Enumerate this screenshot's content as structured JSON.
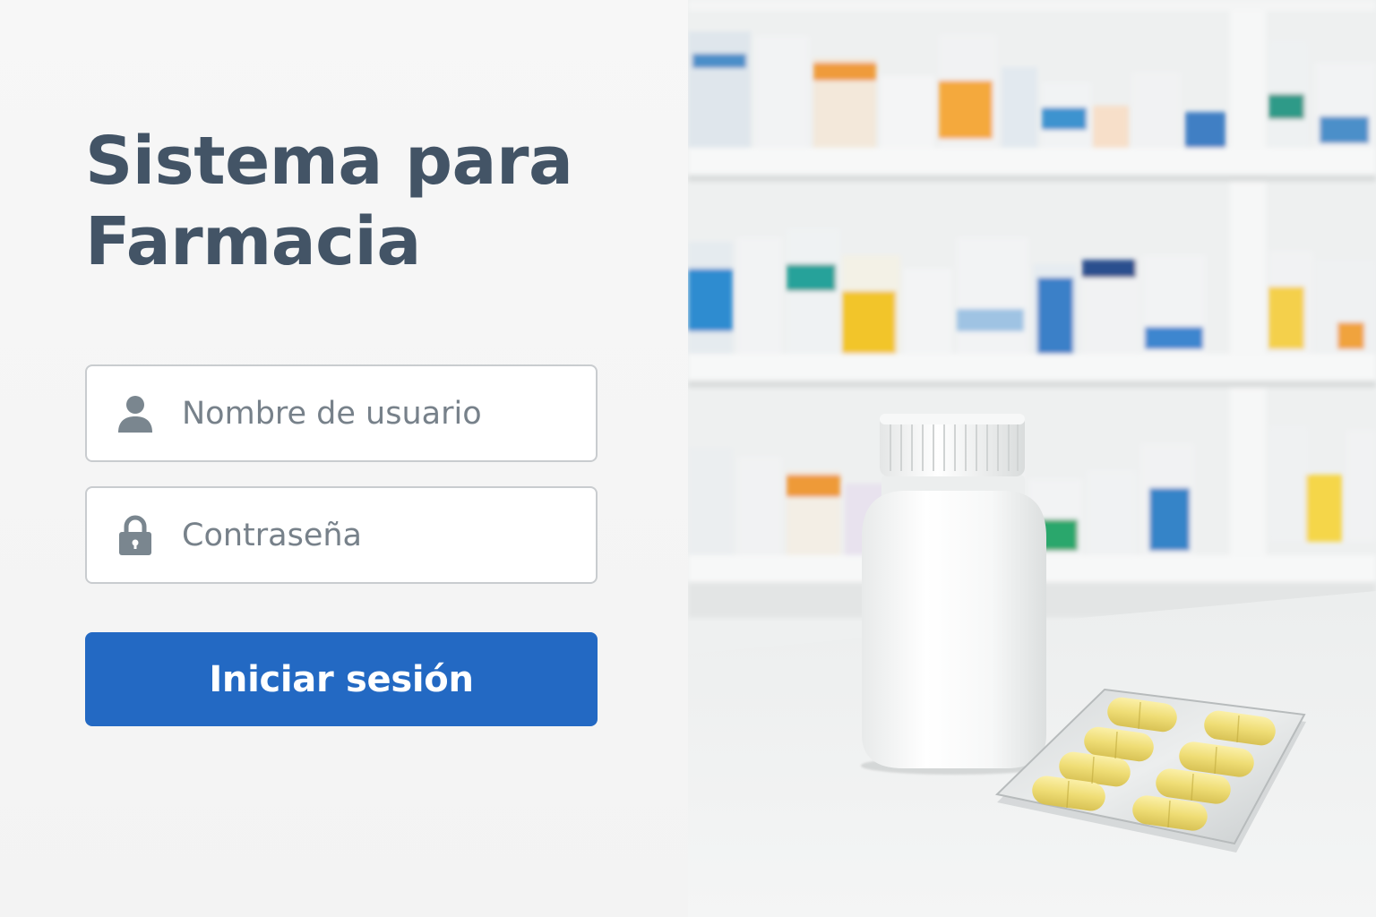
{
  "header": {
    "title": "Sistema para Farmacia"
  },
  "form": {
    "username": {
      "placeholder": "Nombre de usuario",
      "value": "",
      "icon": "user-icon"
    },
    "password": {
      "placeholder": "Contraseña",
      "value": "",
      "icon": "lock-icon"
    },
    "submit_label": "Iniciar sesión"
  },
  "colors": {
    "title": "#435466",
    "button": "#2369c3",
    "field_border": "#c9cccf",
    "icon": "#7a868f"
  },
  "photo": {
    "subject": "pharmacy-shelves-with-pill-bottle-and-blister-pack"
  }
}
